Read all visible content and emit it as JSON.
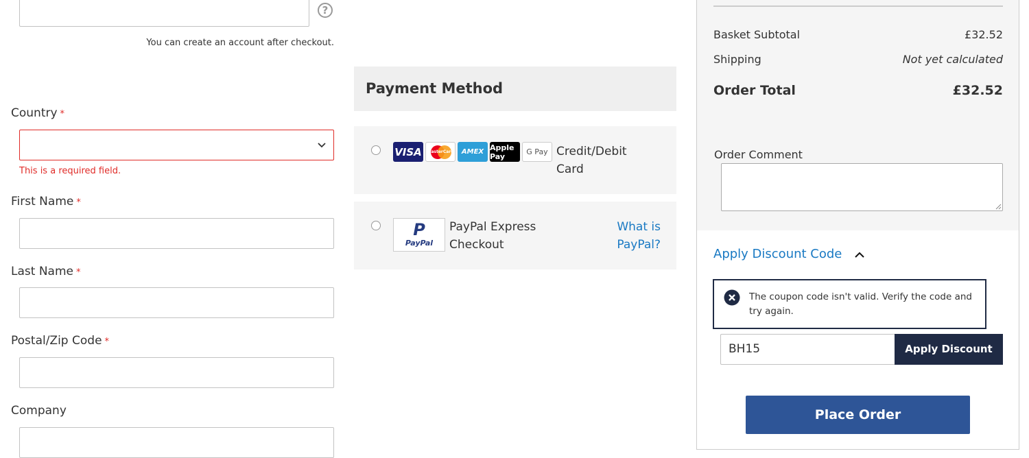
{
  "account": {
    "hint": "You can create an account after checkout.",
    "help_symbol": "?"
  },
  "form": {
    "country": {
      "label": "Country",
      "required_mark": "*",
      "error": "This is a required field."
    },
    "first_name": {
      "label": "First Name",
      "required_mark": "*"
    },
    "last_name": {
      "label": "Last Name",
      "required_mark": "*"
    },
    "postal": {
      "label": "Postal/Zip Code",
      "required_mark": "*"
    },
    "company": {
      "label": "Company"
    }
  },
  "payment": {
    "title": "Payment Method",
    "options": [
      {
        "label_line1": "Credit/Debit",
        "label_line2": "Card",
        "logos": [
          "VISA",
          "MasterCard",
          "AMEX",
          "Apple Pay",
          "G Pay"
        ]
      },
      {
        "label_line1": "PayPal Express",
        "label_line2": "Checkout",
        "help_line1": "What is",
        "help_line2": "PayPal?",
        "logo_text": "PayPal",
        "logo_mark": "P"
      }
    ]
  },
  "summary": {
    "subtotal_label": "Basket Subtotal",
    "subtotal_value": "£32.52",
    "shipping_label": "Shipping",
    "shipping_value": "Not yet calculated",
    "total_label": "Order Total",
    "total_value": "£32.52",
    "comment_label": "Order Comment",
    "discount_toggle": "Apply Discount Code",
    "discount_error": "The coupon code isn't valid. Verify the code and try again.",
    "coupon_value": "BH15",
    "apply_button": "Apply Discount",
    "place_order": "Place Order"
  },
  "colors": {
    "primary_button": "#2e5597",
    "dark_button": "#1f2a44",
    "link": "#1979c3",
    "error": "#e02b27",
    "panel_bg": "#f5f5f5"
  }
}
